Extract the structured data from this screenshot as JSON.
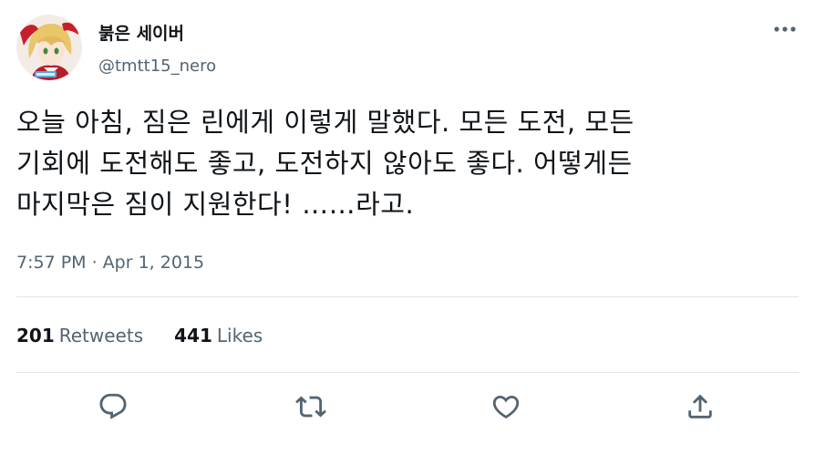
{
  "user": {
    "display_name": "붉은 세이버",
    "handle": "@tmtt15_nero",
    "avatar_icon": "avatar-illustration"
  },
  "tweet": {
    "lines": [
      "오늘 아침, 짐은 린에게 이렇게 말했다. 모든 도전, 모든",
      "기회에 도전해도 좋고, 도전하지 않아도 좋다. 어떻게든",
      "마지막은 짐이 지원한다! ……라고."
    ],
    "timestamp": "7:57 PM · Apr 1, 2015"
  },
  "stats": {
    "retweets_count": "201",
    "retweets_label": "Retweets",
    "likes_count": "441",
    "likes_label": "Likes"
  },
  "actions": {
    "reply_icon": "reply-icon",
    "retweet_icon": "retweet-icon",
    "like_icon": "like-icon",
    "share_icon": "share-icon",
    "more_icon": "more-icon"
  },
  "colors": {
    "text_primary": "#0f1419",
    "text_secondary": "#536471",
    "divider": "#e1e6ea",
    "icon": "#536471"
  }
}
